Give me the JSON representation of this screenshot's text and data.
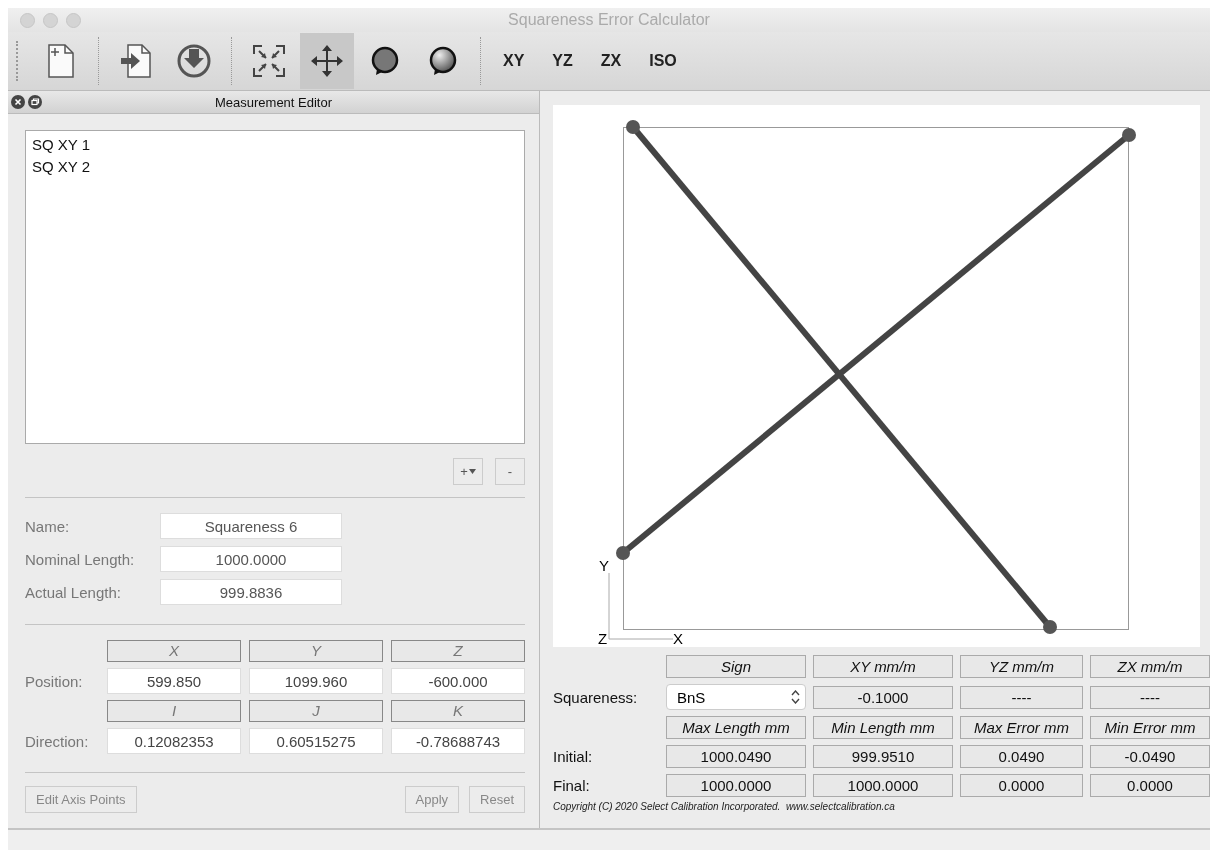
{
  "window": {
    "title": "Squareness Error Calculator"
  },
  "toolbar": {
    "tools": [
      {
        "selected": false
      },
      {
        "selected": false
      },
      {
        "selected": false
      },
      {
        "selected": false
      },
      {
        "selected": true
      },
      {
        "selected": false
      },
      {
        "selected": false
      }
    ],
    "views": [
      {
        "label": "XY",
        "selected": false
      },
      {
        "label": "YZ",
        "selected": false
      },
      {
        "label": "ZX",
        "selected": false
      },
      {
        "label": "ISO",
        "selected": false
      }
    ]
  },
  "editor": {
    "title": "Measurement Editor",
    "items": [
      {
        "label": "SQ XY 1",
        "selected": false
      },
      {
        "label": "SQ XY 2",
        "selected": false
      }
    ],
    "add_button": "+",
    "remove_button": "-",
    "fields": [
      {
        "label": "Name:",
        "value": "Squareness 6"
      },
      {
        "label": "Nominal Length:",
        "value": "1000.0000"
      },
      {
        "label": "Actual Length:",
        "value": "999.8836"
      }
    ],
    "vectors": [
      {
        "label": "Position:",
        "headers": [
          "X",
          "Y",
          "Z"
        ],
        "values": [
          "599.850",
          "1099.960",
          "-600.000"
        ]
      },
      {
        "label": "Direction:",
        "headers": [
          "I",
          "J",
          "K"
        ],
        "values": [
          "0.12082353",
          "0.60515275",
          "-0.78688743"
        ]
      }
    ],
    "buttons": [
      {
        "label": "Edit Axis Points",
        "disabled": true
      },
      {
        "label": "Apply",
        "disabled": true
      },
      {
        "label": "Reset",
        "disabled": true
      }
    ]
  },
  "viewport": {
    "axes": [
      "Y",
      "Z",
      "X"
    ]
  },
  "results": {
    "header_1": [
      "Sign",
      "XY mm/m",
      "YZ mm/m",
      "ZX mm/m"
    ],
    "squareness": {
      "label": "Squareness:",
      "sign": "BnS",
      "values": [
        "-0.1000",
        "----",
        "----"
      ]
    },
    "header_2": [
      "Max Length mm",
      "Min Length mm",
      "Max Error mm",
      "Min Error mm"
    ],
    "rows": [
      {
        "label": "Initial:",
        "values": [
          "1000.0490",
          "999.9510",
          "0.0490",
          "-0.0490"
        ]
      },
      {
        "label": "Final:",
        "values": [
          "1000.0000",
          "1000.0000",
          "0.0000",
          "0.0000"
        ]
      }
    ],
    "copyright": "Copyright (C) 2020 Select Calibration Incorporated.  www.selectcalibration.ca"
  }
}
